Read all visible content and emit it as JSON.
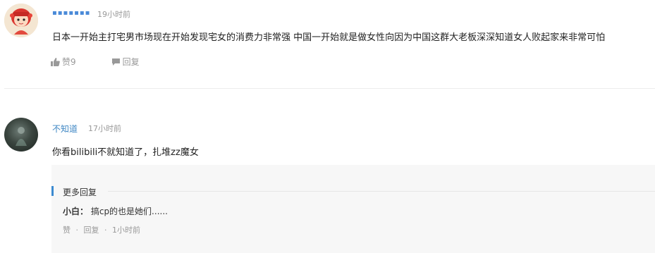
{
  "comments": [
    {
      "username": "▪▪▪▪▪▪▪",
      "time": "19小时前",
      "content": "日本一开始主打宅男市场现在开始发现宅女的消费力非常强 中国一开始就是做女性向因为中国这群大老板深深知道女人败起家来非常可怕",
      "like_label": "赞9",
      "reply_label": "回复",
      "icons": {
        "like": "thumbs-up-icon",
        "reply": "speech-bubble-icon"
      }
    },
    {
      "username": "不知道",
      "time": "17小时前",
      "content": "你看bilibili不就知道了，扎堆zz魔女",
      "replies": {
        "header": "更多回复",
        "items": [
          {
            "name": "小白：",
            "text": "搞cp的也是她们......",
            "like_label": "赞",
            "sep1": "·",
            "reply_label": "回复",
            "sep2": "·",
            "time": "1小时前"
          }
        ]
      }
    }
  ],
  "colors": {
    "accent": "#3c8ad0",
    "username": "#3f87c4",
    "muted": "#999999",
    "reply_bg": "#f7f7f7"
  }
}
